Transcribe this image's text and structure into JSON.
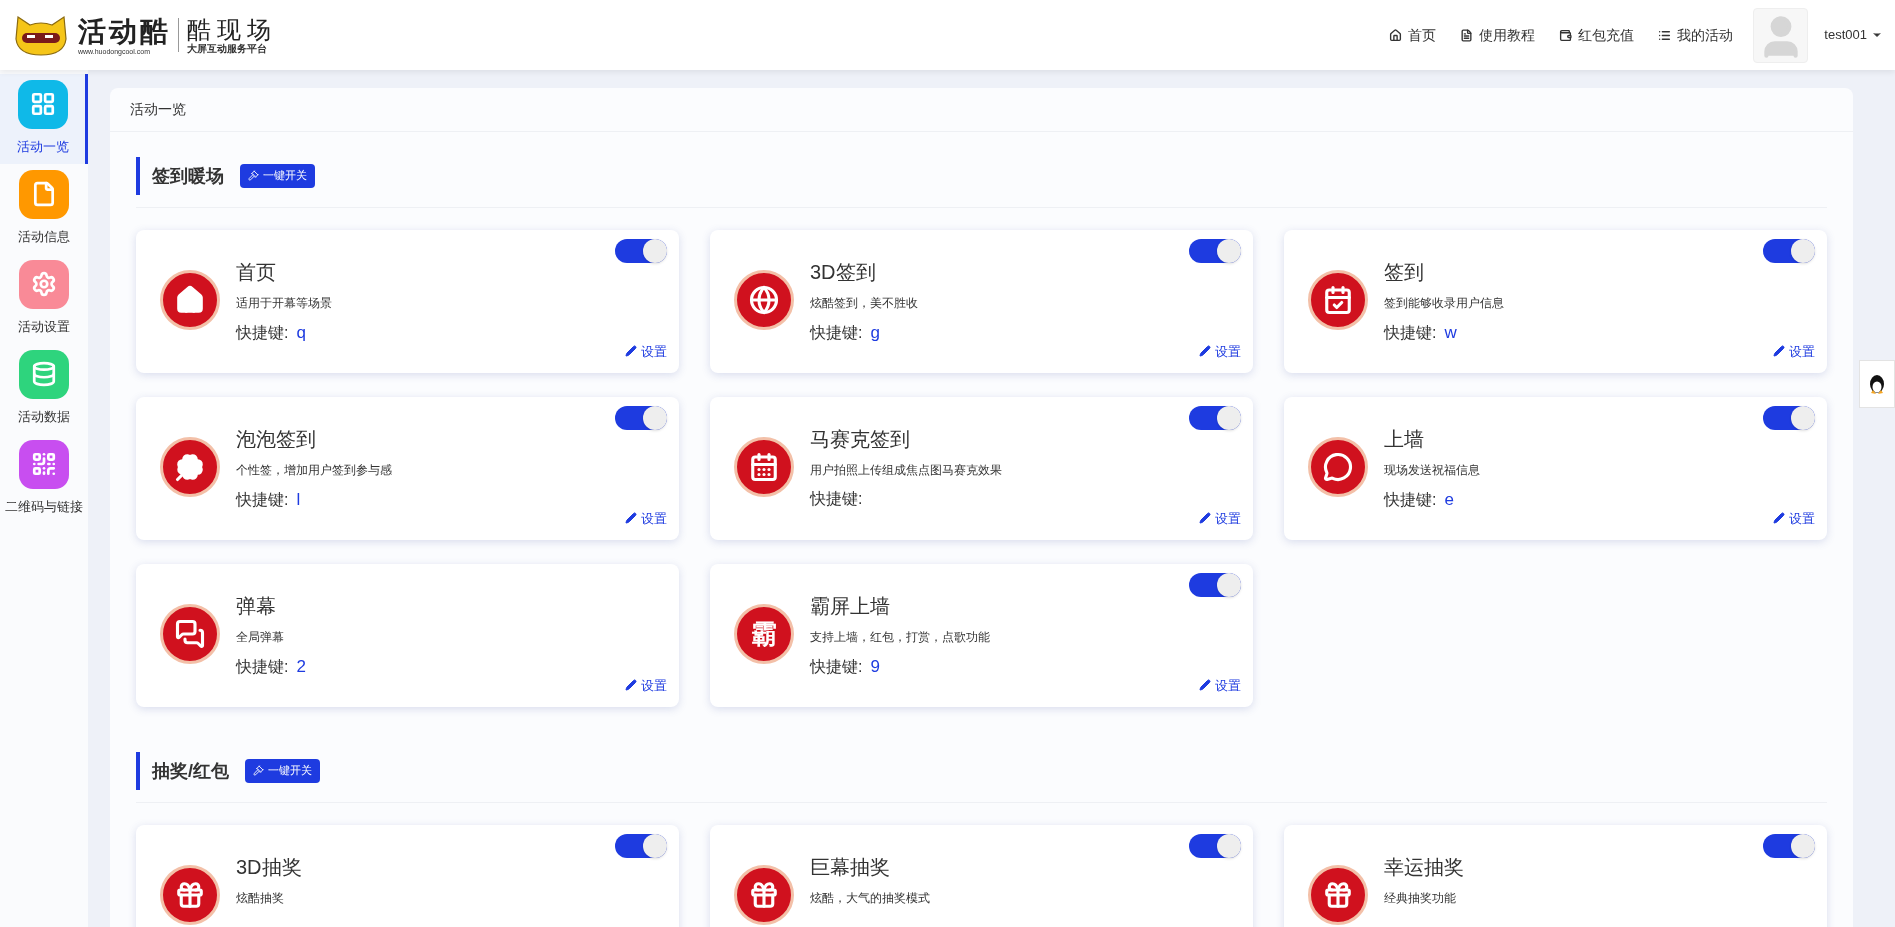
{
  "header": {
    "logo": {
      "brand": "活动酷",
      "url": "www.huodongcool.com",
      "product": "酷现场",
      "tagline": "大屏互动服务平台"
    },
    "nav": [
      {
        "label": "首页"
      },
      {
        "label": "使用教程"
      },
      {
        "label": "红包充值"
      },
      {
        "label": "我的活动"
      }
    ],
    "user": "test001"
  },
  "sidebar": {
    "items": [
      {
        "label": "活动一览",
        "color": "#0fb9e8",
        "selected": true
      },
      {
        "label": "活动信息",
        "color": "#ff9800",
        "selected": false
      },
      {
        "label": "活动设置",
        "color": "#f98a97",
        "selected": false
      },
      {
        "label": "活动数据",
        "color": "#2ed47d",
        "selected": false
      },
      {
        "label": "二维码与链接",
        "color": "#c84ef0",
        "selected": false
      }
    ]
  },
  "panel": {
    "title": "活动一览",
    "sections": [
      {
        "title": "签到暖场",
        "button": "一键开关",
        "cards": [
          {
            "title": "首页",
            "desc": "适用于开幕等场景",
            "shortcut_label": "快捷键:",
            "shortcut": "q",
            "kind": "home",
            "switch": {
              "on": true
            },
            "settings": "设置"
          },
          {
            "title": "3D签到",
            "desc": "炫酷签到，美不胜收",
            "shortcut_label": "快捷键:",
            "shortcut": "g",
            "kind": "globe",
            "switch": {
              "on": true
            },
            "settings": "设置"
          },
          {
            "title": "签到",
            "desc": "签到能够收录用户信息",
            "shortcut_label": "快捷键:",
            "shortcut": "w",
            "kind": "checkin",
            "switch": {
              "on": true
            },
            "settings": "设置"
          },
          {
            "title": "泡泡签到",
            "desc": "个性签，增加用户签到参与感",
            "shortcut_label": "快捷键:",
            "shortcut": "l",
            "kind": "clover",
            "switch": {
              "on": true
            },
            "settings": "设置"
          },
          {
            "title": "马赛克签到",
            "desc": "用户拍照上传组成焦点图马赛克效果",
            "shortcut_label": "快捷键:",
            "kind": "calendar",
            "switch": {
              "on": true
            },
            "settings": "设置"
          },
          {
            "title": "上墙",
            "desc": "现场发送祝福信息",
            "shortcut_label": "快捷键:",
            "shortcut": "e",
            "kind": "bubble",
            "switch": {
              "on": true
            },
            "settings": "设置"
          },
          {
            "title": "弹幕",
            "desc": "全局弹幕",
            "shortcut_label": "快捷键:",
            "shortcut": "2",
            "kind": "chat",
            "settings": "设置"
          },
          {
            "title": "霸屏上墙",
            "desc": "支持上墙，红包，打赏，点歌功能",
            "shortcut_label": "快捷键:",
            "shortcut": "9",
            "kind": "char",
            "icon_text": "霸",
            "switch": {
              "on": true
            },
            "settings": "设置"
          }
        ]
      },
      {
        "title": "抽奖/红包",
        "button": "一键开关",
        "cards": [
          {
            "title": "3D抽奖",
            "desc": "炫酷抽奖",
            "kind": "gift",
            "switch": {
              "on": true
            }
          },
          {
            "title": "巨幕抽奖",
            "desc": "炫酷，大气的抽奖模式",
            "kind": "gift",
            "switch": {
              "on": true
            }
          },
          {
            "title": "幸运抽奖",
            "desc": "经典抽奖功能",
            "kind": "gift",
            "switch": {
              "on": true
            }
          }
        ]
      }
    ]
  }
}
